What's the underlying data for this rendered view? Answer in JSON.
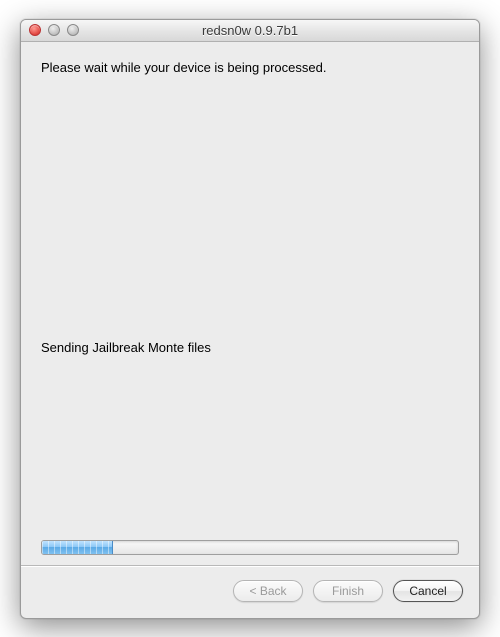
{
  "window": {
    "title": "redsn0w 0.9.7b1"
  },
  "content": {
    "instruction": "Please wait while your device is being processed.",
    "status": "Sending Jailbreak Monte files",
    "progress_percent": 17
  },
  "buttons": {
    "back": "< Back",
    "finish": "Finish",
    "cancel": "Cancel"
  }
}
